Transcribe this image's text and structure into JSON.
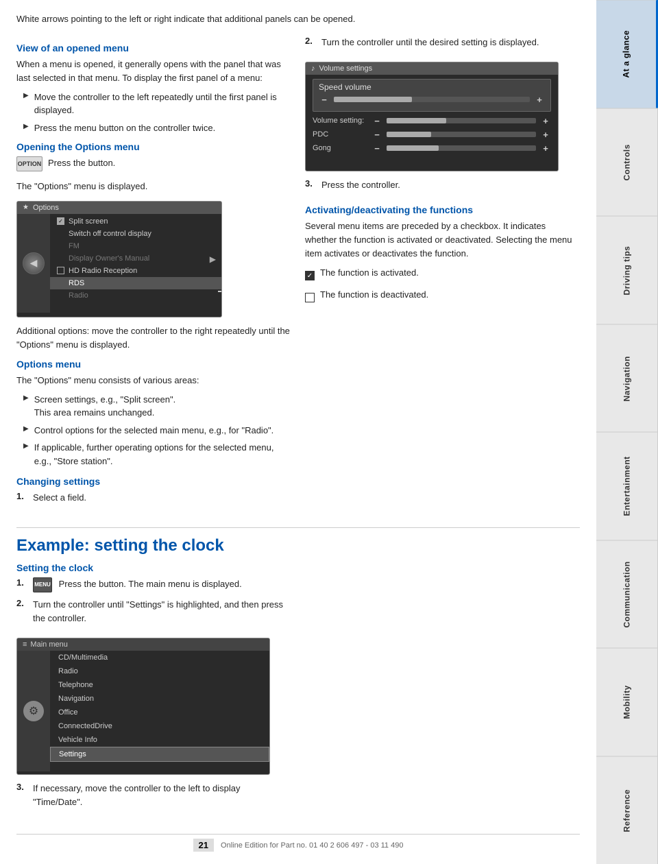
{
  "intro": {
    "text": "White arrows pointing to the left or right indicate that additional panels can be opened."
  },
  "section_opened_menu": {
    "heading": "View of an opened menu",
    "body": "When a menu is opened, it generally opens with the panel that was last selected in that menu. To display the first panel of a menu:",
    "bullets": [
      "Move the controller to the left repeatedly until the first panel is displayed.",
      "Press the menu button on the controller twice."
    ]
  },
  "section_options_menu": {
    "heading": "Opening the Options menu",
    "button_label": "OPTION",
    "body1": "Press the button.",
    "body2": "The \"Options\" menu is displayed.",
    "additional": "Additional options: move the controller to the right repeatedly until the \"Options\" menu is displayed.",
    "sub_heading": "Options menu",
    "sub_body": "The \"Options\" menu consists of various areas:",
    "sub_bullets": [
      {
        "text": "Screen settings, e.g., \"Split screen\".",
        "sub": "This area remains unchanged."
      },
      {
        "text": "Control options for the selected main menu, e.g., for \"Radio\"."
      },
      {
        "text": "If applicable, further operating options for the selected menu, e.g., \"Store station\"."
      }
    ]
  },
  "section_changing_settings": {
    "heading": "Changing settings",
    "step1": "Select a field."
  },
  "section_right_col": {
    "step2_text": "Turn the controller until the desired setting is displayed.",
    "step3_text": "Press the controller.",
    "activating_heading": "Activating/deactivating the functions",
    "activating_body": "Several menu items are preceded by a checkbox. It indicates whether the function is activated or deactivated. Selecting the menu item activates or deactivates the function.",
    "activated_text": "The function is activated.",
    "deactivated_text": "The function is deactivated."
  },
  "example_section": {
    "heading": "Example: setting the clock",
    "sub_heading": "Setting the clock",
    "step1_text": "Press the button. The main menu is displayed.",
    "step2_text": "Turn the controller until \"Settings\" is highlighted, and then press the controller.",
    "step3_text": "If necessary, move the controller to the left to display \"Time/Date\".",
    "menu_button_label": "MENU"
  },
  "options_screen": {
    "title": "Options",
    "title_icon": "★",
    "items": [
      {
        "label": "Split screen",
        "type": "checkbox",
        "checked": true
      },
      {
        "label": "Switch off control display",
        "type": "plain"
      },
      {
        "label": "FM",
        "type": "plain",
        "dim": true
      },
      {
        "label": "Display Owner's Manual",
        "type": "plain"
      },
      {
        "label": "HD Radio Reception",
        "type": "checkbox",
        "checked": false,
        "highlighted": false
      },
      {
        "label": "RDS",
        "type": "plain",
        "highlighted": true
      },
      {
        "label": "Radio",
        "type": "plain",
        "dim": true
      }
    ]
  },
  "volume_screen": {
    "title": "Volume settings",
    "title_icon": "♪",
    "speed_volume_label": "Speed volume",
    "rows": [
      {
        "label": "Volume setting:",
        "fill": 40
      },
      {
        "label": "PDC",
        "fill": 30
      },
      {
        "label": "Gong",
        "fill": 35
      }
    ]
  },
  "main_menu_screen": {
    "title": "Main menu",
    "title_icon": "≡",
    "items": [
      "CD/Multimedia",
      "Radio",
      "Telephone",
      "Navigation",
      "Office",
      "ConnectedDrive",
      "Vehicle Info",
      "Settings"
    ],
    "selected_item": "Settings"
  },
  "sidebar": {
    "tabs": [
      {
        "label": "At a glance",
        "active": true
      },
      {
        "label": "Controls"
      },
      {
        "label": "Driving tips"
      },
      {
        "label": "Navigation"
      },
      {
        "label": "Entertainment"
      },
      {
        "label": "Communication"
      },
      {
        "label": "Mobility"
      },
      {
        "label": "Reference"
      }
    ]
  },
  "footer": {
    "page_number": "21",
    "text": "Online Edition for Part no. 01 40 2 606 497 - 03 11 490"
  }
}
